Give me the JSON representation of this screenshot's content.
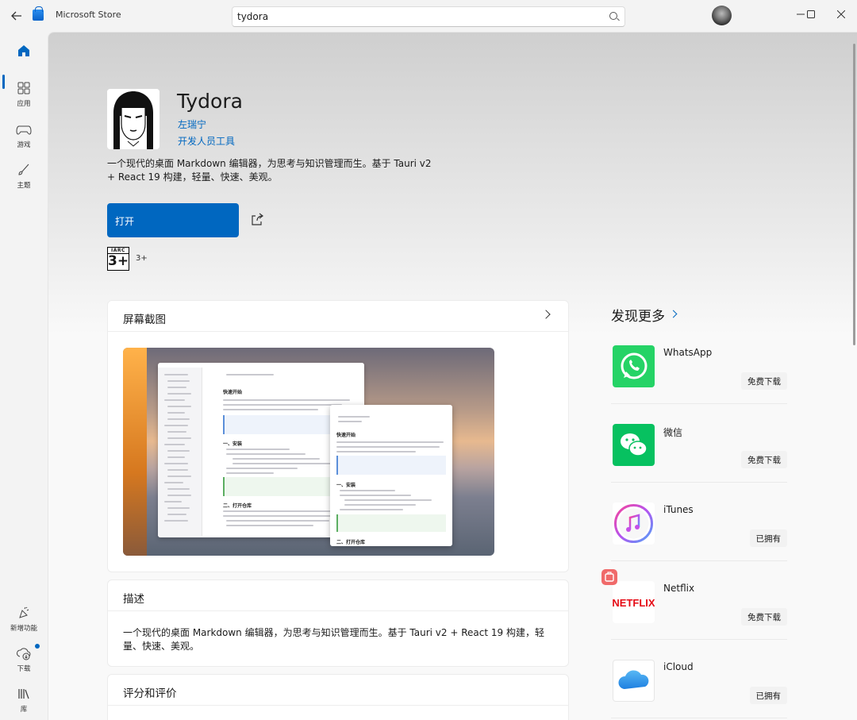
{
  "titlebar": {
    "app_title": "Microsoft Store",
    "search_value": "tydora"
  },
  "sidebar": {
    "items": [
      {
        "label": "",
        "icon": "home-icon"
      },
      {
        "label": "应用",
        "icon": "apps-icon"
      },
      {
        "label": "游戏",
        "icon": "gamepad-icon"
      },
      {
        "label": "主题",
        "icon": "brush-icon"
      }
    ],
    "bottom_items": [
      {
        "label": "新增功能",
        "icon": "whats-new-icon"
      },
      {
        "label": "下载",
        "icon": "download-icon"
      },
      {
        "label": "库",
        "icon": "library-icon"
      }
    ]
  },
  "product": {
    "name": "Tydora",
    "publisher": "左瑞宁",
    "category": "开发人员工具",
    "short_description": "一个现代的桌面 Markdown 编辑器，为思考与知识管理而生。基于 Tauri v2 + React 19 构建，轻量、快速、美观。",
    "open_label": "打开",
    "age_rating_org": "IARC",
    "age_rating_value": "3+",
    "age_rating_text": "3+"
  },
  "sections": {
    "screenshots_title": "屏幕截图",
    "description_title": "描述",
    "description_body": "一个现代的桌面 Markdown 编辑器，为思考与知识管理而生。基于 Tauri v2 + React 19 构建，轻量、快速、美观。",
    "ratings_title": "评分和评价"
  },
  "screenshot_texts": {
    "heading": "快速开始",
    "section1": "一、安装",
    "section2": "二、打开仓库"
  },
  "discover": {
    "title": "发现更多",
    "apps": [
      {
        "name": "WhatsApp",
        "action": "免费下载",
        "icon": "whatsapp-icon"
      },
      {
        "name": "微信",
        "action": "免费下载",
        "icon": "wechat-icon"
      },
      {
        "name": "iTunes",
        "action": "已拥有",
        "icon": "itunes-icon"
      },
      {
        "name": "Netflix",
        "action": "免费下载",
        "icon": "netflix-icon",
        "logo_text": "NETFLIX"
      },
      {
        "name": "iCloud",
        "action": "已拥有",
        "icon": "icloud-icon"
      }
    ]
  },
  "colors": {
    "accent": "#0067c0",
    "whatsapp": "#25d366",
    "wechat": "#07c160",
    "netflix": "#e50914"
  }
}
